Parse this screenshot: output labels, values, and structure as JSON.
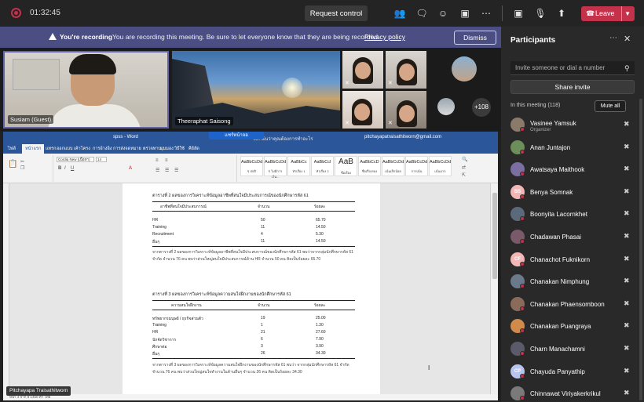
{
  "topbar": {
    "timer": "01:32:45",
    "request_control_label": "Request control",
    "leave_label": "Leave",
    "icons": [
      "people-icon",
      "chat-icon",
      "reactions-icon",
      "rooms-icon",
      "more-icon",
      "camera-off-icon",
      "mic-off-icon",
      "share-icon"
    ]
  },
  "banner": {
    "title": "You're recording",
    "message": "You are recording this meeting. Be sure to let everyone know that they are being recorded.",
    "link": "Privacy policy",
    "dismiss_label": "Dismiss"
  },
  "video_strip": {
    "tiles": [
      {
        "name": "Susiam (Guest)"
      },
      {
        "name": "Theeraphat Saisong"
      }
    ],
    "overflow_count": "+108"
  },
  "shared_screen": {
    "sharing_label": "แชร์หน้าจอ",
    "presenter": "Pitchayapa Traisathitworn",
    "word": {
      "filename": "spss - Word",
      "search_placeholder": "บอกฉันว่าคุณต้องการทำอะไร",
      "user": "pitchayapatraisathitworn@gmail.com",
      "tabs": [
        "ไฟล์",
        "หน้าแรก",
        "แทรก",
        "ออกแบบ",
        "เค้าโครง",
        "การอ้างอิง",
        "การส่งจดหมาย",
        "ตรวจทาน",
        "มุมมอง",
        "วิธีใช้",
        "คีย์ลัด"
      ],
      "font_name": "Cordia New (เนื้อหา)",
      "font_size": "14",
      "styles": [
        {
          "sample": "AaBbCcDd",
          "name": "¶ ปกติ"
        },
        {
          "sample": "AaBbCcDd",
          "name": "¶ ไม่มีการเว้น..."
        },
        {
          "sample": "AaBbCc",
          "name": "หัวเรื่อง 1"
        },
        {
          "sample": "AaBbCcl",
          "name": "หัวเรื่อง 2"
        },
        {
          "sample": "AaB",
          "name": "ชื่อเรื่อง"
        },
        {
          "sample": "AaBbCcD",
          "name": "ชื่อเรื่องรอง"
        },
        {
          "sample": "AaBbCcDd",
          "name": "เน้นเล็กน้อย"
        },
        {
          "sample": "AaBbCcDd",
          "name": "การเน้น"
        },
        {
          "sample": "AaBbCcDd",
          "name": "เน้นมาก"
        }
      ],
      "table2": {
        "caption": "ตารางที่ 2 ผลของการวิเคราะห์ข้อมูลอาชีพที่สนใจมีประสบการณ์ของนักศึกษารหัส 61",
        "headers": [
          "อาชีพที่สนใจมีประสบการณ์",
          "จำนวน",
          "ร้อยละ"
        ],
        "rows": [
          [
            "HR",
            "50",
            "65.70"
          ],
          [
            "Training",
            "11",
            "14.50"
          ],
          [
            "Recruitment",
            "4",
            "5.30"
          ],
          [
            "อื่นๆ",
            "11",
            "14.50"
          ]
        ],
        "paragraph": "จากตารางที่ 2 ผลของการวิเคราะห์ข้อมูลอาชีพที่สนใจมีประสบการณ์ของนักศึกษารหัส 61 พบว่าจากกลุ่มนักศึกษารหัส 61 จำกัด จำนวน 76 คน พบว่าส่วนใหญ่สนใจมีประสบการณ์ด้าน HR จำนวน 50 คน คิดเป็นร้อยละ 65.70"
      },
      "table3": {
        "caption": "ตารางที่ 3 ผลของการวิเคราะห์ข้อมูลความสนใจฝึกงานของนักศึกษารหัส 61",
        "headers": [
          "ความสนใจฝึกงาน",
          "จำนวน",
          "ร้อยละ"
        ],
        "rows": [
          [
            "ทรัพยากรมนุษย์ / ธุรกิจส่วนตัว",
            "19",
            "25.00"
          ],
          [
            "Training",
            "1",
            "1.30"
          ],
          [
            "HR",
            "21",
            "27.60"
          ],
          [
            "นักจัดวิชาการ",
            "6",
            "7.90"
          ],
          [
            "ศึกษาต่อ",
            "3",
            "3.90"
          ],
          [
            "อื่นๆ",
            "26",
            "34.30"
          ]
        ],
        "paragraph": "จากตารางที่ 3 ผลของการวิเคราะห์ข้อมูลความสนใจฝึกงานของนักศึกษารหัส 61 พบว่า จากกลุ่มนักศึกษารหัส 61 จำกัด จำนวน 76 คน พบว่าส่วนใหญ่สนใจทำงานในด้านอื่นๆ จำนวน 26 คน คิดเป็นร้อยละ 34.30"
      },
      "status": "หน้า 4 จาก 8   1450 คำ   ไทย"
    }
  },
  "participants": {
    "title": "Participants",
    "invite_placeholder": "Invite someone or dial a number",
    "share_invite_label": "Share invite",
    "in_meeting_label": "In this meeting (118)",
    "mute_all_label": "Mute all",
    "people": [
      {
        "name": "Vasinee Yamsuk",
        "role": "Organizer",
        "initials": "",
        "color": "#8a7a6a"
      },
      {
        "name": "Anan Juntajon",
        "role": "",
        "initials": "",
        "color": "#6b8e5a"
      },
      {
        "name": "Awatsaya Maithook",
        "role": "",
        "initials": "",
        "color": "#7a6fa0"
      },
      {
        "name": "Benya Somnak",
        "role": "",
        "initials": "BS",
        "color": "#f3b6b6"
      },
      {
        "name": "Boonyita Lacornkhet",
        "role": "",
        "initials": "",
        "color": "#5a6a7a"
      },
      {
        "name": "Chadawan Phasai",
        "role": "",
        "initials": "",
        "color": "#7a5a6a"
      },
      {
        "name": "Chanachot Fuknikorn",
        "role": "",
        "initials": "CF",
        "color": "#f3b6b6"
      },
      {
        "name": "Chanakan Nimphung",
        "role": "",
        "initials": "",
        "color": "#6a7a8a"
      },
      {
        "name": "Chanakan Phaensomboon",
        "role": "",
        "initials": "",
        "color": "#8a6a5a"
      },
      {
        "name": "Chanakan Puangraya",
        "role": "",
        "initials": "",
        "color": "#d08a4a"
      },
      {
        "name": "Charn Manachamni",
        "role": "",
        "initials": "",
        "color": "#5a5a6a"
      },
      {
        "name": "Chayuda Panyathip",
        "role": "",
        "initials": "CP",
        "color": "#b7c4f0"
      },
      {
        "name": "Chinnawat Viriyakerkrikul",
        "role": "",
        "initials": "",
        "color": "#7a7a7a"
      }
    ]
  }
}
